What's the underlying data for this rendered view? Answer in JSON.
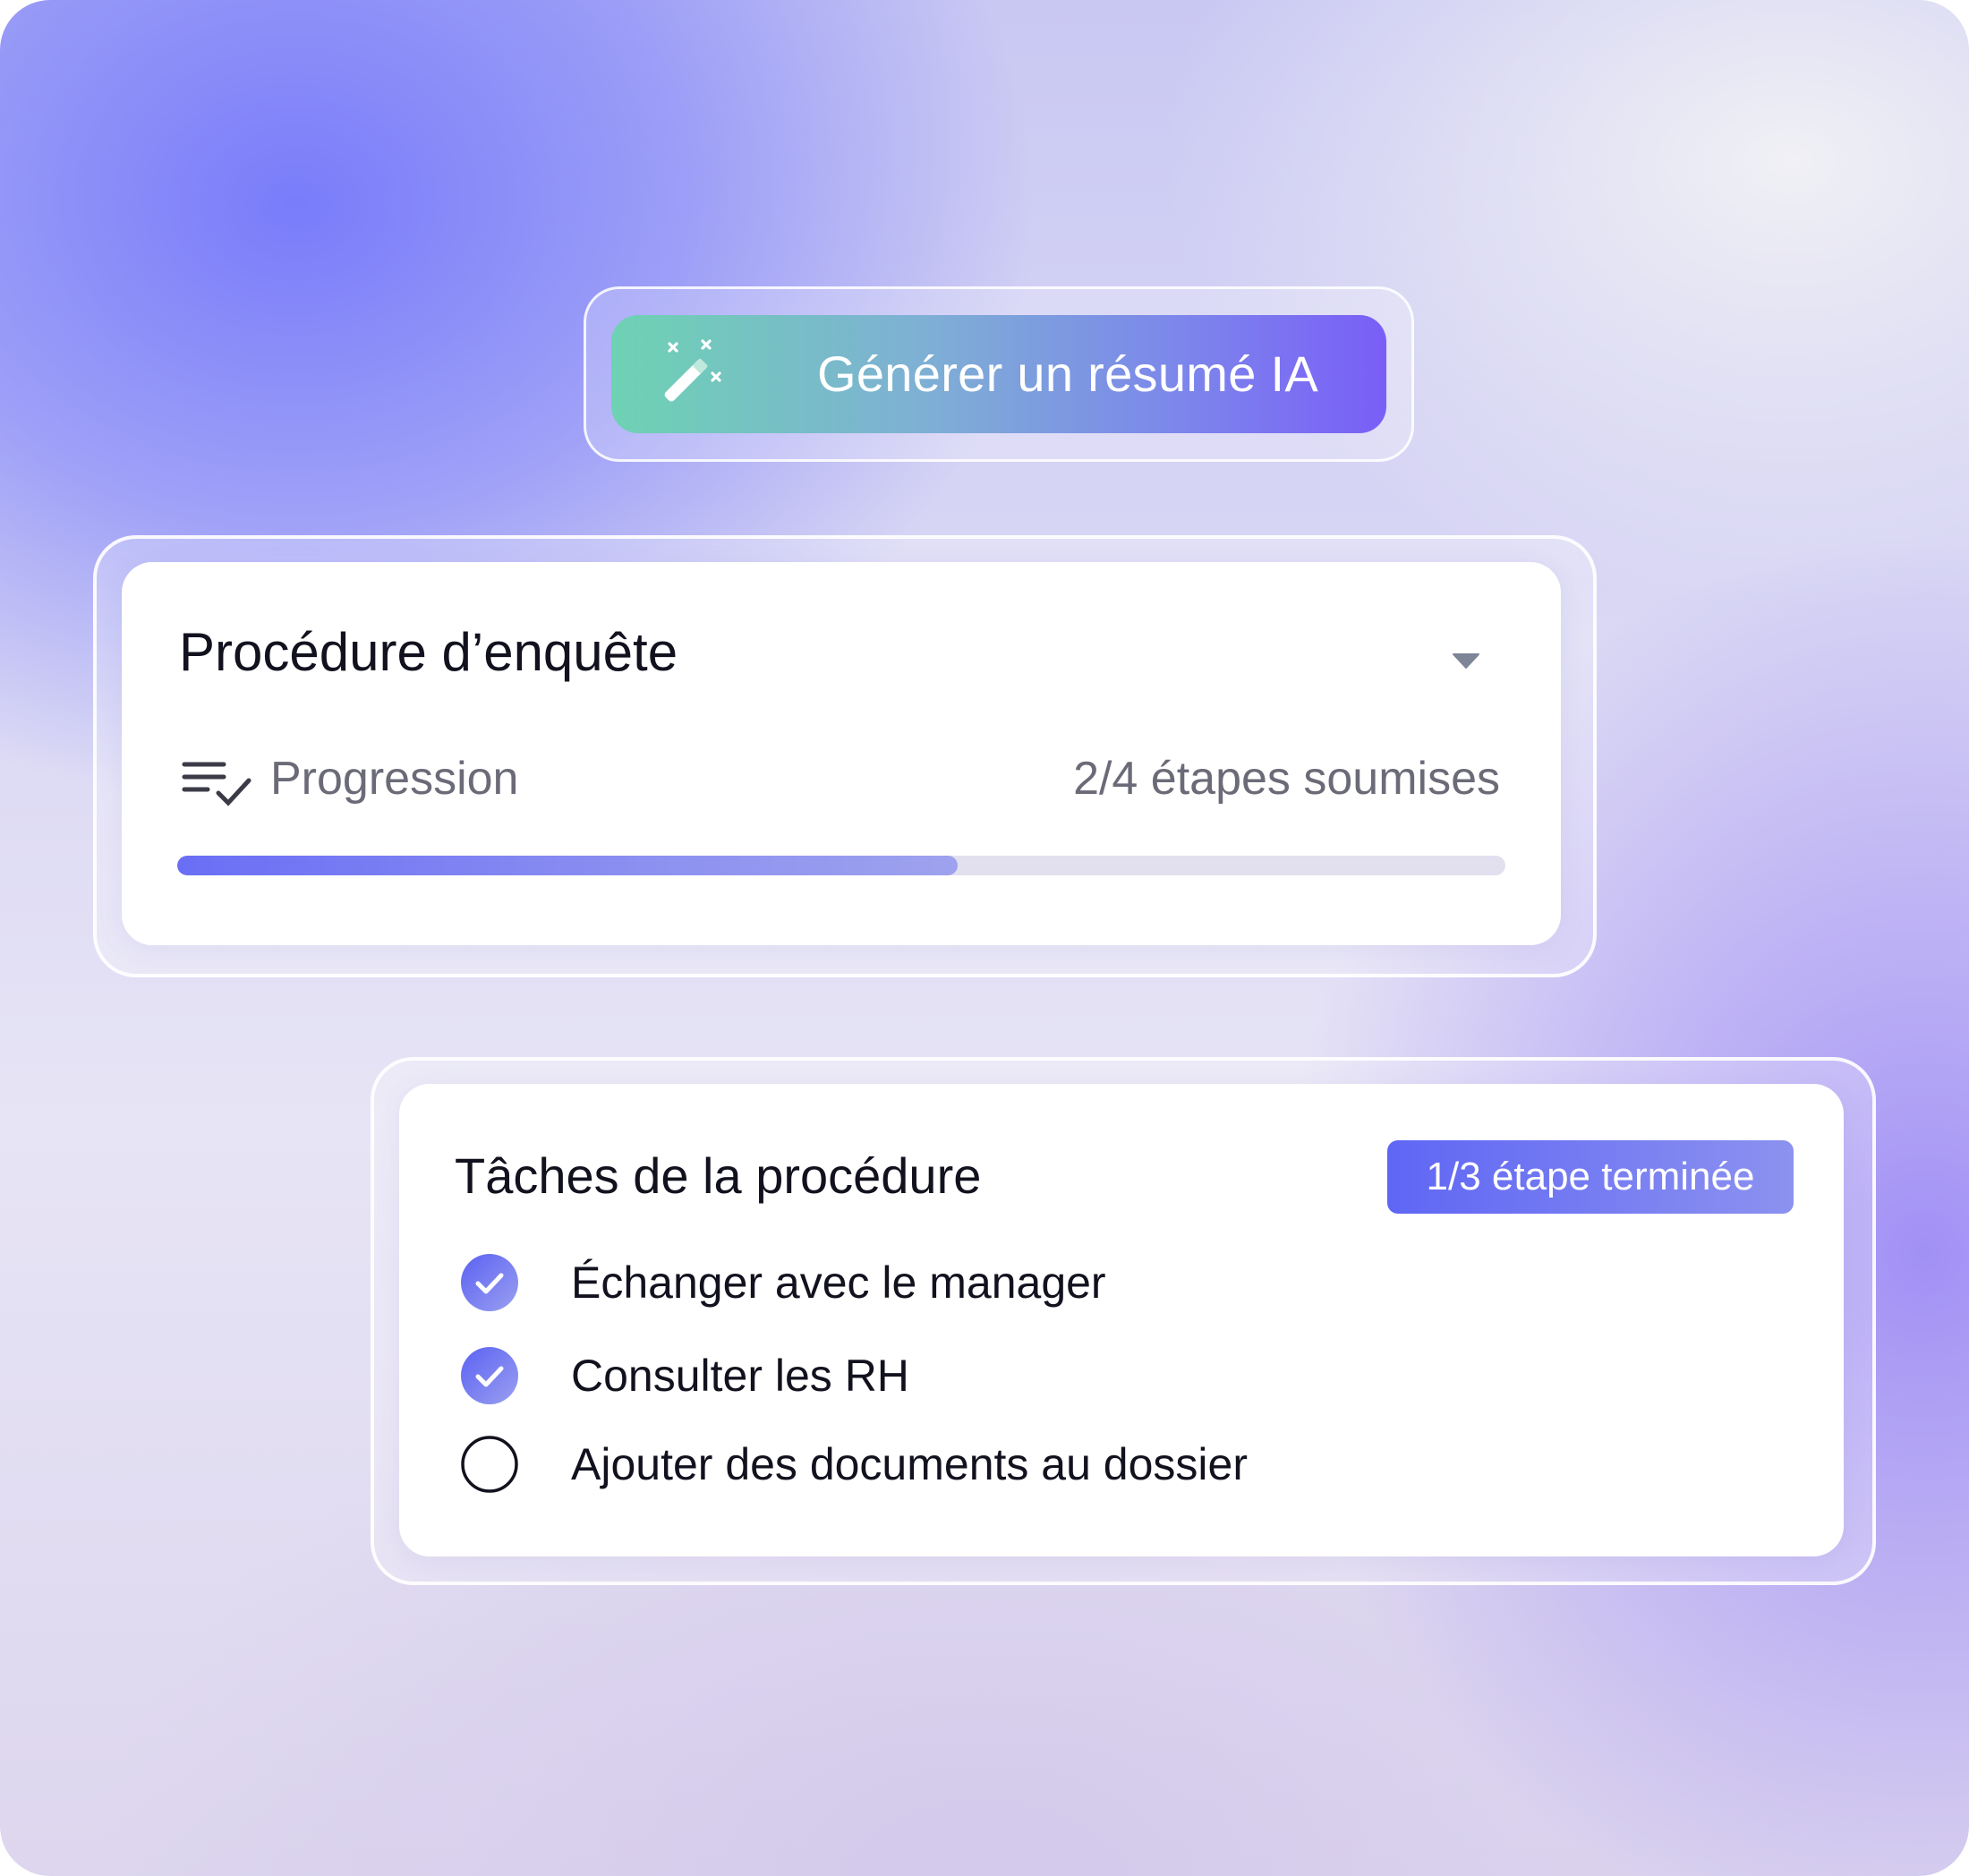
{
  "ai_button": {
    "label": "Générer un résumé IA",
    "icon": "magic-wand-icon"
  },
  "procedure_card": {
    "title": "Procédure d’enquête",
    "dropdown_icon": "caret-down-icon",
    "progress": {
      "icon": "list-check-icon",
      "label": "Progression",
      "status": "2/4 étapes soumises",
      "fraction": 0.5
    }
  },
  "tasks_card": {
    "title": "Tâches de la procédure",
    "badge": "1/3 étape terminée",
    "tasks": [
      {
        "label": "Échanger avec le manager",
        "done": true
      },
      {
        "label": "Consulter les RH",
        "done": true
      },
      {
        "label": "Ajouter des documents au dossier",
        "done": false
      }
    ]
  },
  "colors": {
    "accent": "#6a6ef5",
    "badge_start": "#5f66f4",
    "button_start": "#6ed2b3",
    "button_end": "#7a5ef7",
    "track": "#e2e0ef"
  }
}
